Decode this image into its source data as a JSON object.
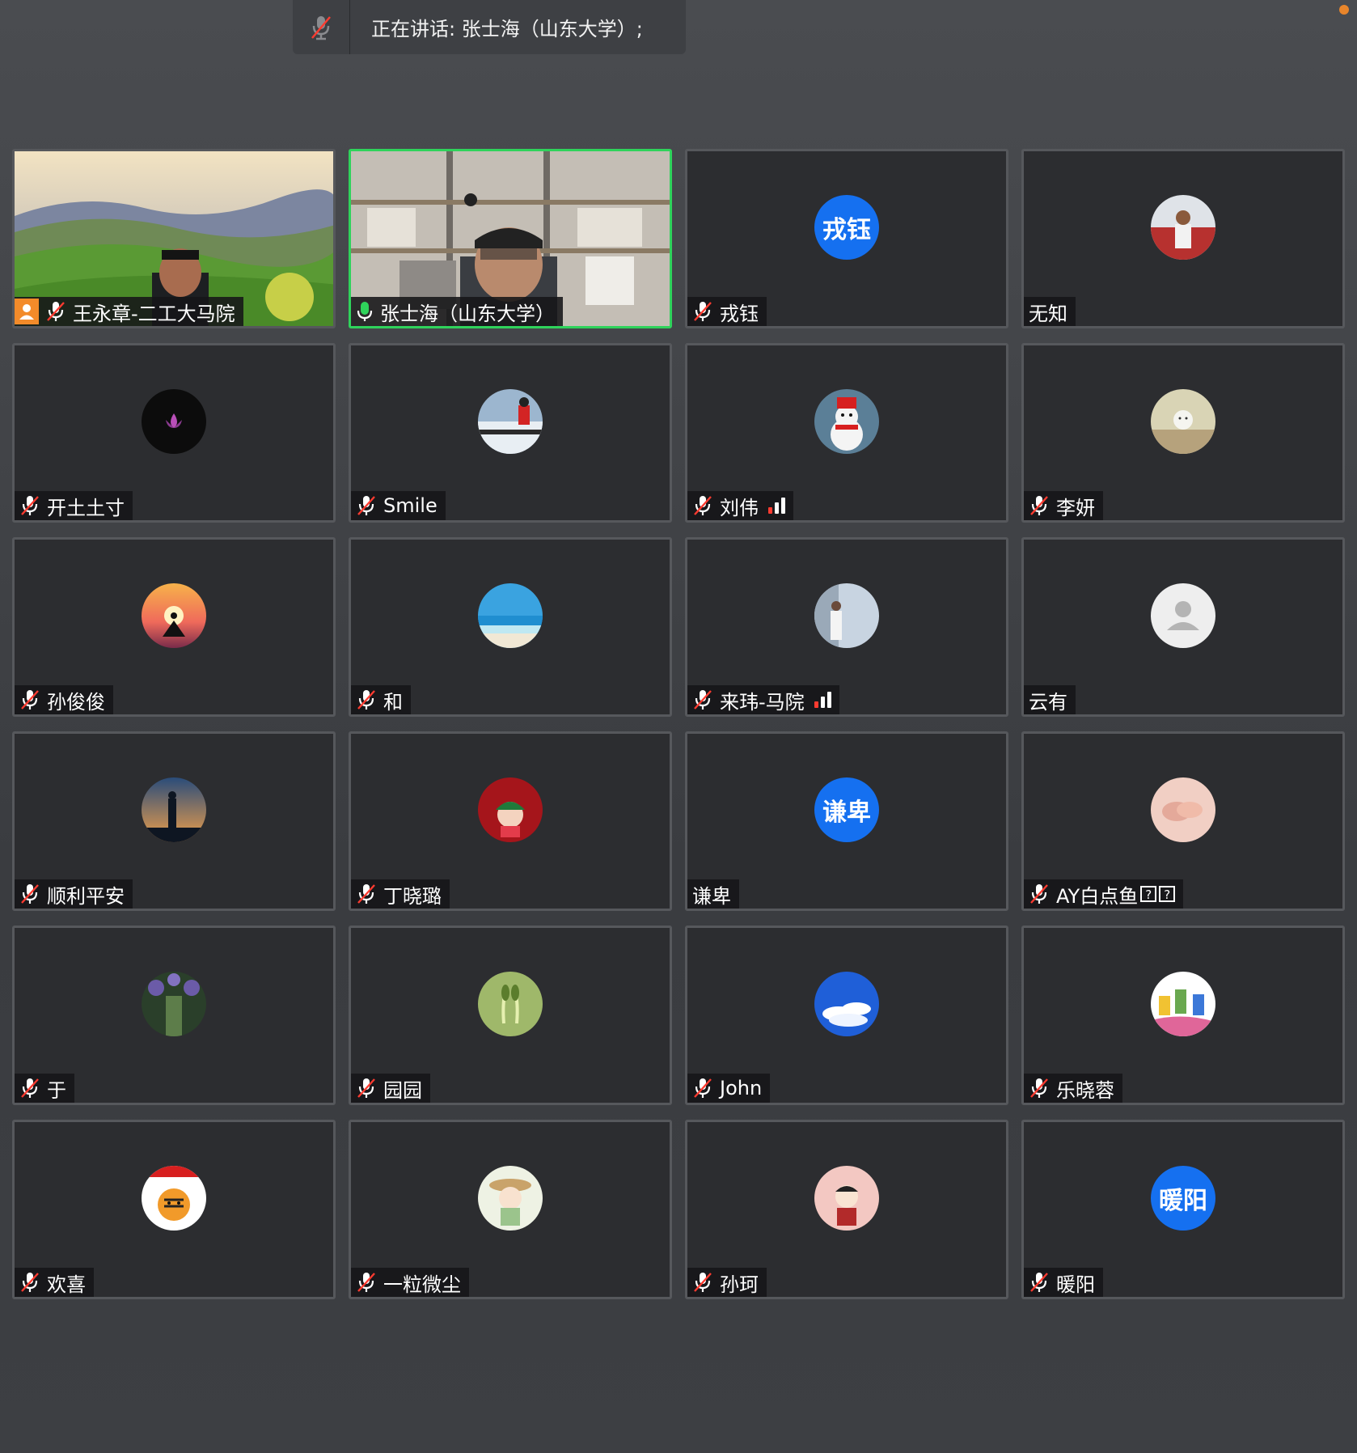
{
  "speaking_bar": {
    "text": "正在讲话: 张士海（山东大学）;"
  },
  "colors": {
    "active_border": "#2fd35b",
    "avatar_text_bg": "#1570f0",
    "mute_slash": "#ff3b30",
    "host_badge": "#f38b2a"
  },
  "participants": [
    {
      "name": "王永章-二工大马院",
      "type": "video",
      "scene": "landscape",
      "muted": true,
      "host": true
    },
    {
      "name": "张士海（山东大学）",
      "type": "video",
      "scene": "office",
      "muted": false,
      "speaking": true
    },
    {
      "name": "戎钰",
      "type": "text",
      "avatar_text": "戎钰",
      "muted": true
    },
    {
      "name": "无知",
      "type": "image",
      "avatar_icon": "person-car-photo",
      "muted": false
    },
    {
      "name": "开土土寸",
      "type": "image",
      "avatar_icon": "lotus-photo",
      "muted": true
    },
    {
      "name": "Smile",
      "type": "image",
      "avatar_icon": "snow-person-photo",
      "muted": true
    },
    {
      "name": "刘伟",
      "type": "image",
      "avatar_icon": "snowman-photo",
      "muted": true,
      "signal": true
    },
    {
      "name": "李妍",
      "type": "image",
      "avatar_icon": "cartoon-rabbit-photo",
      "muted": true
    },
    {
      "name": "孙俊俊",
      "type": "image",
      "avatar_icon": "yoga-sunset-photo",
      "muted": true
    },
    {
      "name": "和",
      "type": "image",
      "avatar_icon": "ocean-photo",
      "muted": true
    },
    {
      "name": "来玮-马院",
      "type": "image",
      "avatar_icon": "girl-window-photo",
      "muted": true,
      "signal": true
    },
    {
      "name": "云有",
      "type": "placeholder",
      "avatar_icon": "default-user-icon",
      "muted": false
    },
    {
      "name": "顺利平安",
      "type": "image",
      "avatar_icon": "silhouette-photo",
      "muted": true
    },
    {
      "name": "丁晓璐",
      "type": "image",
      "avatar_icon": "red-cartoon-photo",
      "muted": true
    },
    {
      "name": "谦卑",
      "type": "text",
      "avatar_text": "谦卑",
      "muted": false
    },
    {
      "name": "AY白点鱼",
      "type": "image",
      "avatar_icon": "holding-hands-photo",
      "muted": true,
      "qmarks": 2
    },
    {
      "name": "于",
      "type": "image",
      "avatar_icon": "wisteria-path-photo",
      "muted": true
    },
    {
      "name": "园园",
      "type": "image",
      "avatar_icon": "sprouts-photo",
      "muted": true
    },
    {
      "name": "John",
      "type": "image",
      "avatar_icon": "blue-sky-clouds-photo",
      "muted": true
    },
    {
      "name": "乐晓蓉",
      "type": "image",
      "avatar_icon": "colorful-drawing-photo",
      "muted": true
    },
    {
      "name": "欢喜",
      "type": "image",
      "avatar_icon": "tiger-newyear-photo",
      "muted": true
    },
    {
      "name": "一粒微尘",
      "type": "image",
      "avatar_icon": "cartoon-girl-hat-photo",
      "muted": true
    },
    {
      "name": "孙珂",
      "type": "image",
      "avatar_icon": "cartoon-boy-photo",
      "muted": true
    },
    {
      "name": "暖阳",
      "type": "text",
      "avatar_text": "暖阳",
      "muted": true
    }
  ]
}
